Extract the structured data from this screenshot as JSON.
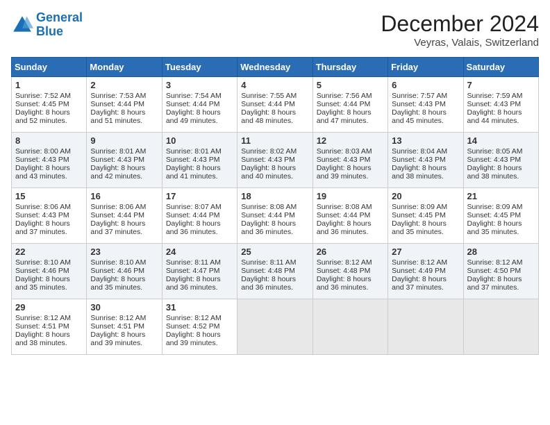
{
  "logo": {
    "line1": "General",
    "line2": "Blue"
  },
  "title": "December 2024",
  "location": "Veyras, Valais, Switzerland",
  "weekdays": [
    "Sunday",
    "Monday",
    "Tuesday",
    "Wednesday",
    "Thursday",
    "Friday",
    "Saturday"
  ],
  "weeks": [
    [
      {
        "day": "1",
        "sunrise": "Sunrise: 7:52 AM",
        "sunset": "Sunset: 4:45 PM",
        "daylight": "Daylight: 8 hours and 52 minutes."
      },
      {
        "day": "2",
        "sunrise": "Sunrise: 7:53 AM",
        "sunset": "Sunset: 4:44 PM",
        "daylight": "Daylight: 8 hours and 51 minutes."
      },
      {
        "day": "3",
        "sunrise": "Sunrise: 7:54 AM",
        "sunset": "Sunset: 4:44 PM",
        "daylight": "Daylight: 8 hours and 49 minutes."
      },
      {
        "day": "4",
        "sunrise": "Sunrise: 7:55 AM",
        "sunset": "Sunset: 4:44 PM",
        "daylight": "Daylight: 8 hours and 48 minutes."
      },
      {
        "day": "5",
        "sunrise": "Sunrise: 7:56 AM",
        "sunset": "Sunset: 4:44 PM",
        "daylight": "Daylight: 8 hours and 47 minutes."
      },
      {
        "day": "6",
        "sunrise": "Sunrise: 7:57 AM",
        "sunset": "Sunset: 4:43 PM",
        "daylight": "Daylight: 8 hours and 45 minutes."
      },
      {
        "day": "7",
        "sunrise": "Sunrise: 7:59 AM",
        "sunset": "Sunset: 4:43 PM",
        "daylight": "Daylight: 8 hours and 44 minutes."
      }
    ],
    [
      {
        "day": "8",
        "sunrise": "Sunrise: 8:00 AM",
        "sunset": "Sunset: 4:43 PM",
        "daylight": "Daylight: 8 hours and 43 minutes."
      },
      {
        "day": "9",
        "sunrise": "Sunrise: 8:01 AM",
        "sunset": "Sunset: 4:43 PM",
        "daylight": "Daylight: 8 hours and 42 minutes."
      },
      {
        "day": "10",
        "sunrise": "Sunrise: 8:01 AM",
        "sunset": "Sunset: 4:43 PM",
        "daylight": "Daylight: 8 hours and 41 minutes."
      },
      {
        "day": "11",
        "sunrise": "Sunrise: 8:02 AM",
        "sunset": "Sunset: 4:43 PM",
        "daylight": "Daylight: 8 hours and 40 minutes."
      },
      {
        "day": "12",
        "sunrise": "Sunrise: 8:03 AM",
        "sunset": "Sunset: 4:43 PM",
        "daylight": "Daylight: 8 hours and 39 minutes."
      },
      {
        "day": "13",
        "sunrise": "Sunrise: 8:04 AM",
        "sunset": "Sunset: 4:43 PM",
        "daylight": "Daylight: 8 hours and 38 minutes."
      },
      {
        "day": "14",
        "sunrise": "Sunrise: 8:05 AM",
        "sunset": "Sunset: 4:43 PM",
        "daylight": "Daylight: 8 hours and 38 minutes."
      }
    ],
    [
      {
        "day": "15",
        "sunrise": "Sunrise: 8:06 AM",
        "sunset": "Sunset: 4:43 PM",
        "daylight": "Daylight: 8 hours and 37 minutes."
      },
      {
        "day": "16",
        "sunrise": "Sunrise: 8:06 AM",
        "sunset": "Sunset: 4:44 PM",
        "daylight": "Daylight: 8 hours and 37 minutes."
      },
      {
        "day": "17",
        "sunrise": "Sunrise: 8:07 AM",
        "sunset": "Sunset: 4:44 PM",
        "daylight": "Daylight: 8 hours and 36 minutes."
      },
      {
        "day": "18",
        "sunrise": "Sunrise: 8:08 AM",
        "sunset": "Sunset: 4:44 PM",
        "daylight": "Daylight: 8 hours and 36 minutes."
      },
      {
        "day": "19",
        "sunrise": "Sunrise: 8:08 AM",
        "sunset": "Sunset: 4:44 PM",
        "daylight": "Daylight: 8 hours and 36 minutes."
      },
      {
        "day": "20",
        "sunrise": "Sunrise: 8:09 AM",
        "sunset": "Sunset: 4:45 PM",
        "daylight": "Daylight: 8 hours and 35 minutes."
      },
      {
        "day": "21",
        "sunrise": "Sunrise: 8:09 AM",
        "sunset": "Sunset: 4:45 PM",
        "daylight": "Daylight: 8 hours and 35 minutes."
      }
    ],
    [
      {
        "day": "22",
        "sunrise": "Sunrise: 8:10 AM",
        "sunset": "Sunset: 4:46 PM",
        "daylight": "Daylight: 8 hours and 35 minutes."
      },
      {
        "day": "23",
        "sunrise": "Sunrise: 8:10 AM",
        "sunset": "Sunset: 4:46 PM",
        "daylight": "Daylight: 8 hours and 35 minutes."
      },
      {
        "day": "24",
        "sunrise": "Sunrise: 8:11 AM",
        "sunset": "Sunset: 4:47 PM",
        "daylight": "Daylight: 8 hours and 36 minutes."
      },
      {
        "day": "25",
        "sunrise": "Sunrise: 8:11 AM",
        "sunset": "Sunset: 4:48 PM",
        "daylight": "Daylight: 8 hours and 36 minutes."
      },
      {
        "day": "26",
        "sunrise": "Sunrise: 8:12 AM",
        "sunset": "Sunset: 4:48 PM",
        "daylight": "Daylight: 8 hours and 36 minutes."
      },
      {
        "day": "27",
        "sunrise": "Sunrise: 8:12 AM",
        "sunset": "Sunset: 4:49 PM",
        "daylight": "Daylight: 8 hours and 37 minutes."
      },
      {
        "day": "28",
        "sunrise": "Sunrise: 8:12 AM",
        "sunset": "Sunset: 4:50 PM",
        "daylight": "Daylight: 8 hours and 37 minutes."
      }
    ],
    [
      {
        "day": "29",
        "sunrise": "Sunrise: 8:12 AM",
        "sunset": "Sunset: 4:51 PM",
        "daylight": "Daylight: 8 hours and 38 minutes."
      },
      {
        "day": "30",
        "sunrise": "Sunrise: 8:12 AM",
        "sunset": "Sunset: 4:51 PM",
        "daylight": "Daylight: 8 hours and 39 minutes."
      },
      {
        "day": "31",
        "sunrise": "Sunrise: 8:12 AM",
        "sunset": "Sunset: 4:52 PM",
        "daylight": "Daylight: 8 hours and 39 minutes."
      },
      null,
      null,
      null,
      null
    ]
  ]
}
